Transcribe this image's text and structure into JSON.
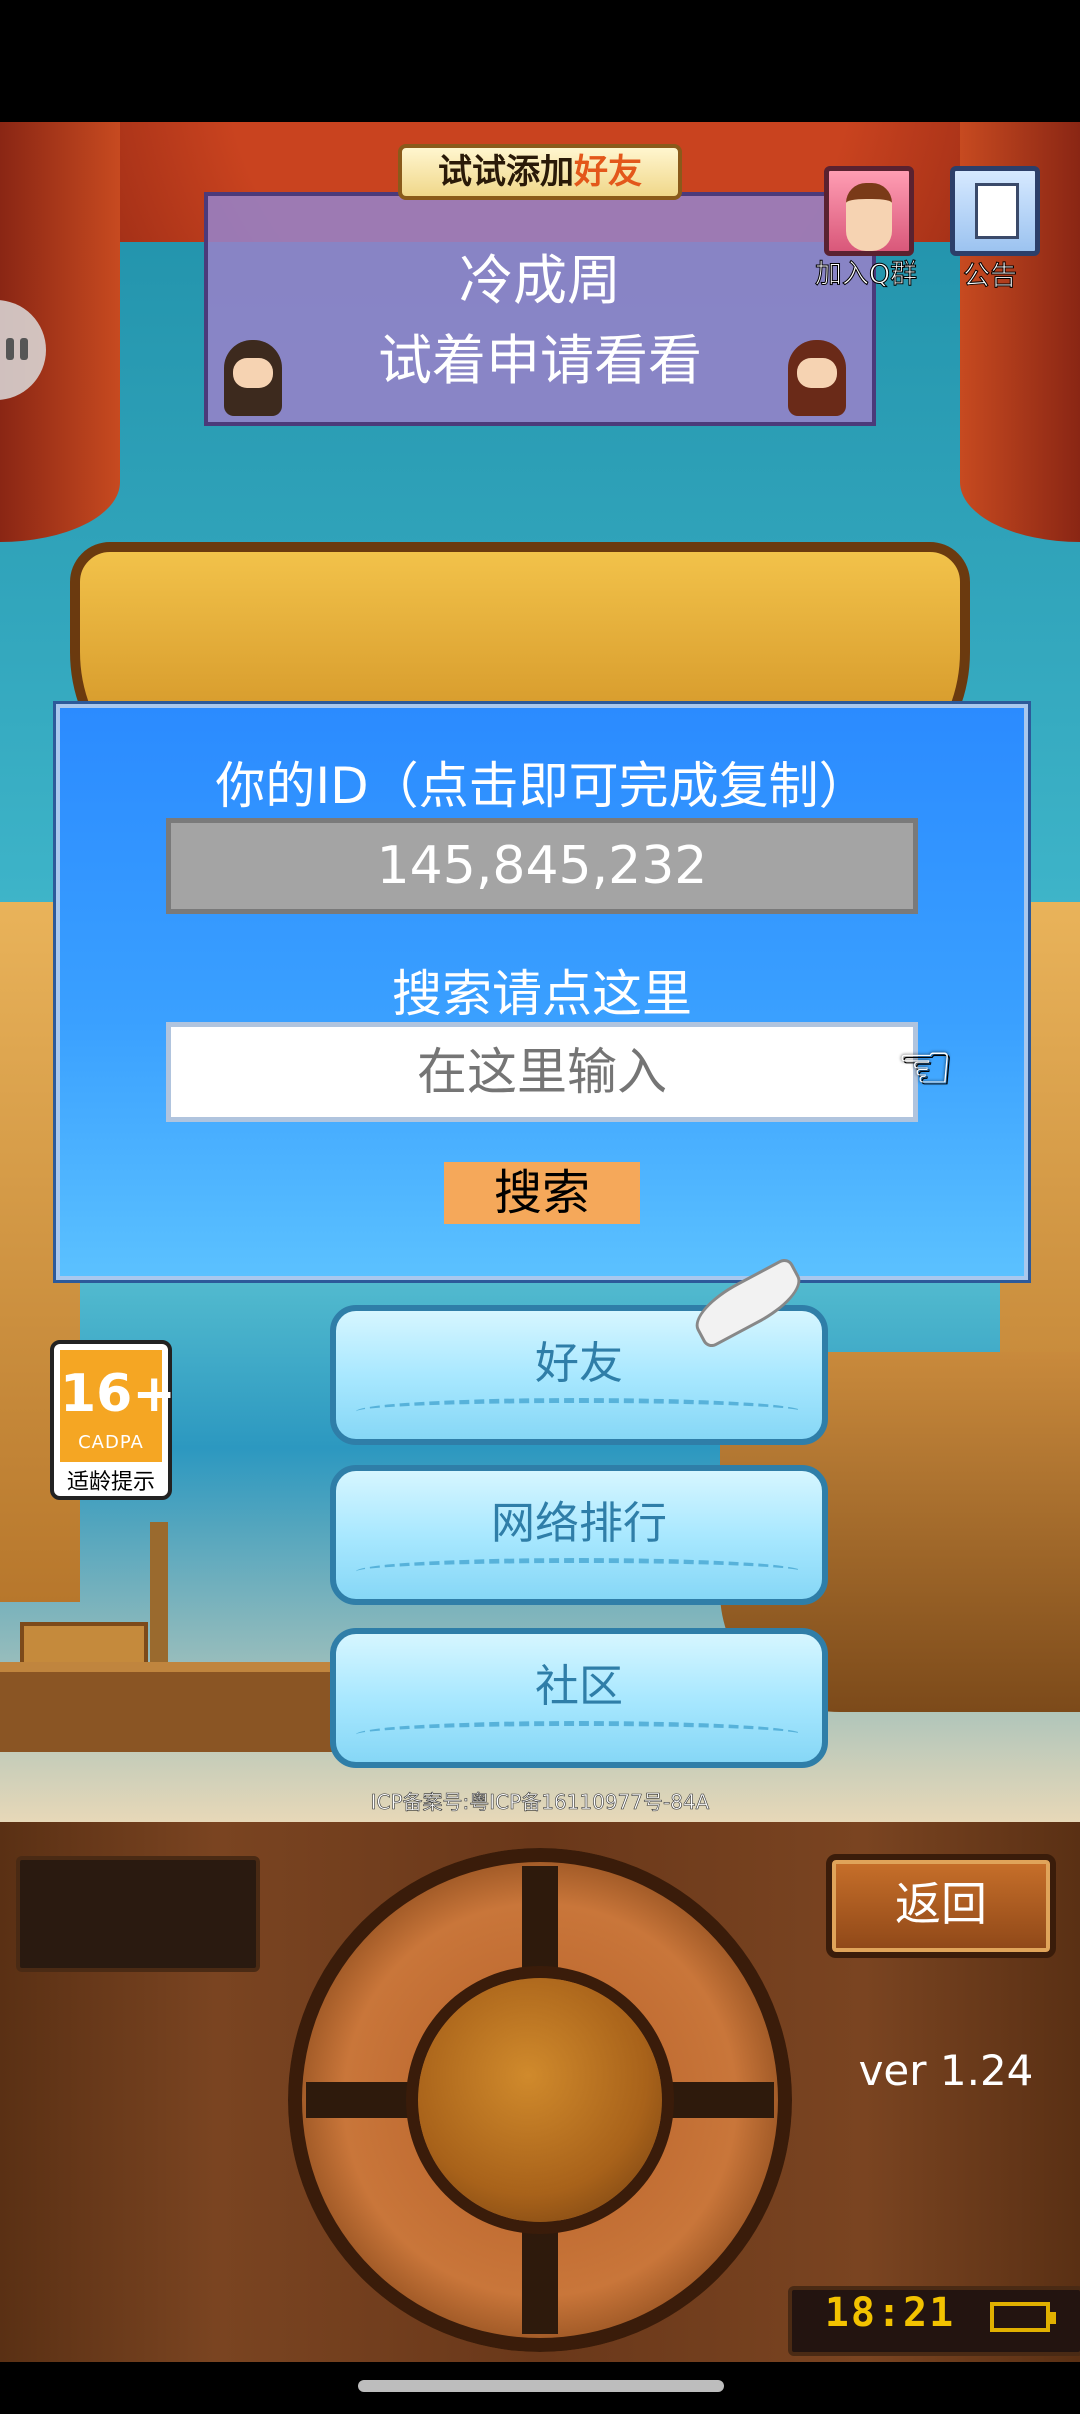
{
  "banner": {
    "title_prefix": "试试添加",
    "title_highlight": "好友",
    "player_name": "冷成周",
    "message": "试着申请看看"
  },
  "top_buttons": {
    "qq_label": "加入Q群",
    "notice_label": "公告"
  },
  "dialog": {
    "title": "你的ID（点击即可完成复制）",
    "id_value": "145,845,232",
    "search_hint": "搜索请点这里",
    "search_placeholder": "在这里输入",
    "search_button": "搜索"
  },
  "menu": {
    "friends": "好友",
    "ranking": "网络排行",
    "community": "社区"
  },
  "age_badge": {
    "rating": "16+",
    "org": "CADPA",
    "tip": "适龄提示"
  },
  "icp": "ICP备案号:粤ICP备16110977号-84A",
  "console": {
    "back_label": "返回",
    "version": "ver 1.24",
    "clock": "18:21"
  },
  "icons": [
    "pause-handle",
    "qq-group-icon",
    "notice-icon",
    "pointer-hand-icon",
    "quill-icon",
    "battery-icon"
  ]
}
